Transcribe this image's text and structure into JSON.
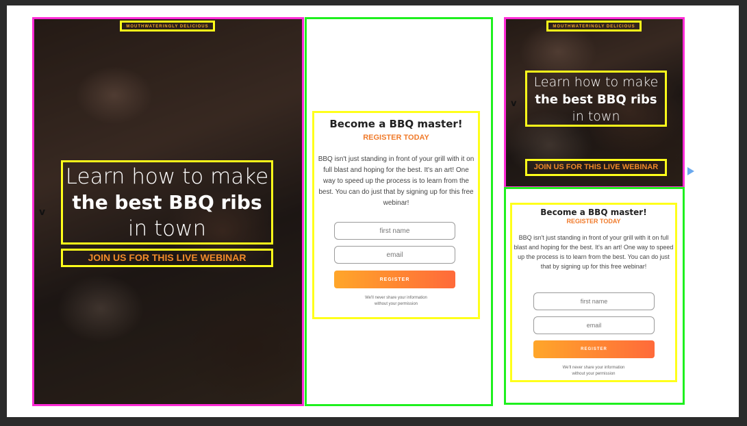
{
  "hero": {
    "eyebrow": "MOUTHWATERINGLY DELICIOUS",
    "headline_line1": "Learn how to make",
    "headline_line2": "the best BBQ ribs",
    "headline_line3": "in town",
    "cta": "JOIN US FOR THIS LIVE WEBINAR"
  },
  "form": {
    "title": "Become a BBQ master!",
    "subtitle": "REGISTER TODAY",
    "body": "BBQ isn't just standing in front of your grill with it on full blast and hoping for the best. It's an art! One way to speed up the process is to learn from the best. You can do just that by signing up for this free webinar!",
    "first_name_placeholder": "first name",
    "email_placeholder": "email",
    "register_label": "REGISTER",
    "privacy_line1": "We'll never share your information",
    "privacy_line2": "without your permission"
  },
  "handle_label": "v",
  "colors": {
    "frame_highlight": "#ff2bd6",
    "section_highlight": "#1ef01e",
    "element_highlight": "#ffff1a",
    "accent": "#f08a2a"
  }
}
